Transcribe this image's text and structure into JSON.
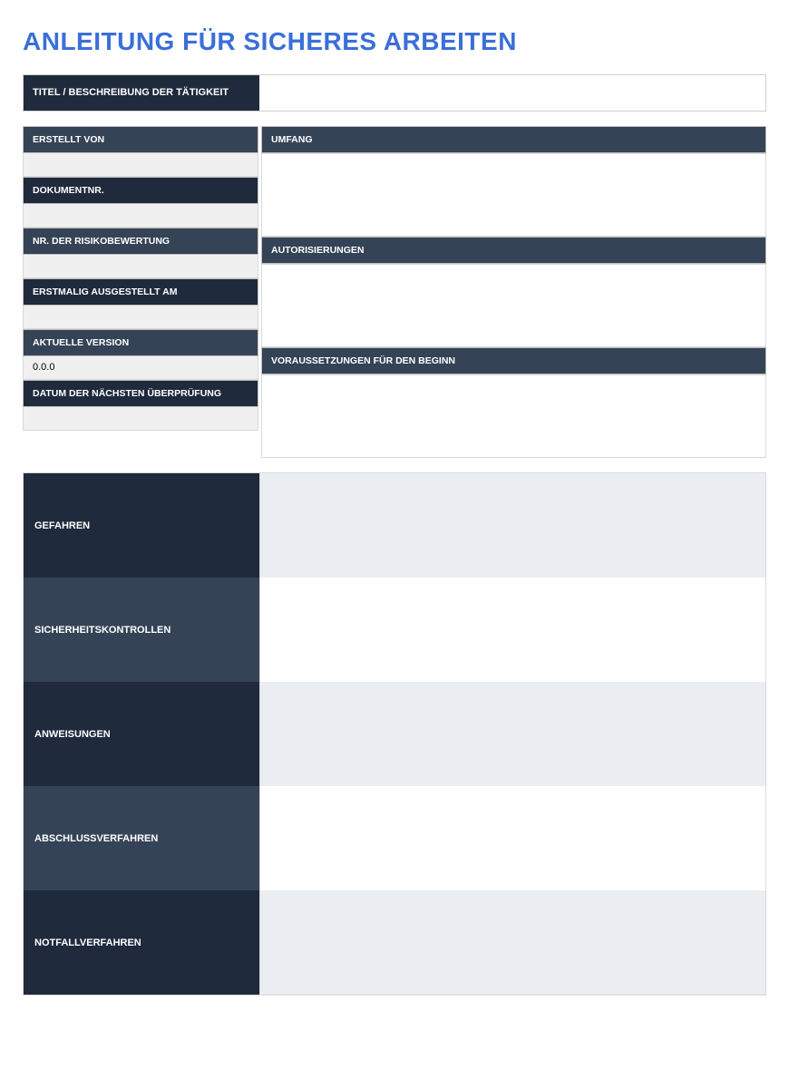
{
  "title": "ANLEITUNG FÜR SICHERES ARBEITEN",
  "section_title": {
    "label": "TITEL / BESCHREIBUNG DER TÄTIGKEIT",
    "value": ""
  },
  "meta_left": [
    {
      "label": "ERSTELLT VON",
      "value": ""
    },
    {
      "label": "DOKUMENTNR.",
      "value": ""
    },
    {
      "label": "NR. DER RISIKOBEWERTUNG",
      "value": ""
    },
    {
      "label": "ERSTMALIG AUSGESTELLT AM",
      "value": ""
    },
    {
      "label": "AKTUELLE VERSION",
      "value": "0.0.0"
    },
    {
      "label": "DATUM DER NÄCHSTEN ÜBERPRÜFUNG",
      "value": ""
    }
  ],
  "meta_right": [
    {
      "label": "UMFANG",
      "value": ""
    },
    {
      "label": "AUTORISIERUNGEN",
      "value": ""
    },
    {
      "label": "VORAUSSETZUNGEN FÜR DEN BEGINN",
      "value": ""
    }
  ],
  "big_sections": [
    {
      "label": "GEFAHREN",
      "value": ""
    },
    {
      "label": "SICHERHEITSKONTROLLEN",
      "value": ""
    },
    {
      "label": "ANWEISUNGEN",
      "value": ""
    },
    {
      "label": "ABSCHLUSSVERFAHREN",
      "value": ""
    },
    {
      "label": "NOTFALLVERFAHREN",
      "value": ""
    }
  ]
}
